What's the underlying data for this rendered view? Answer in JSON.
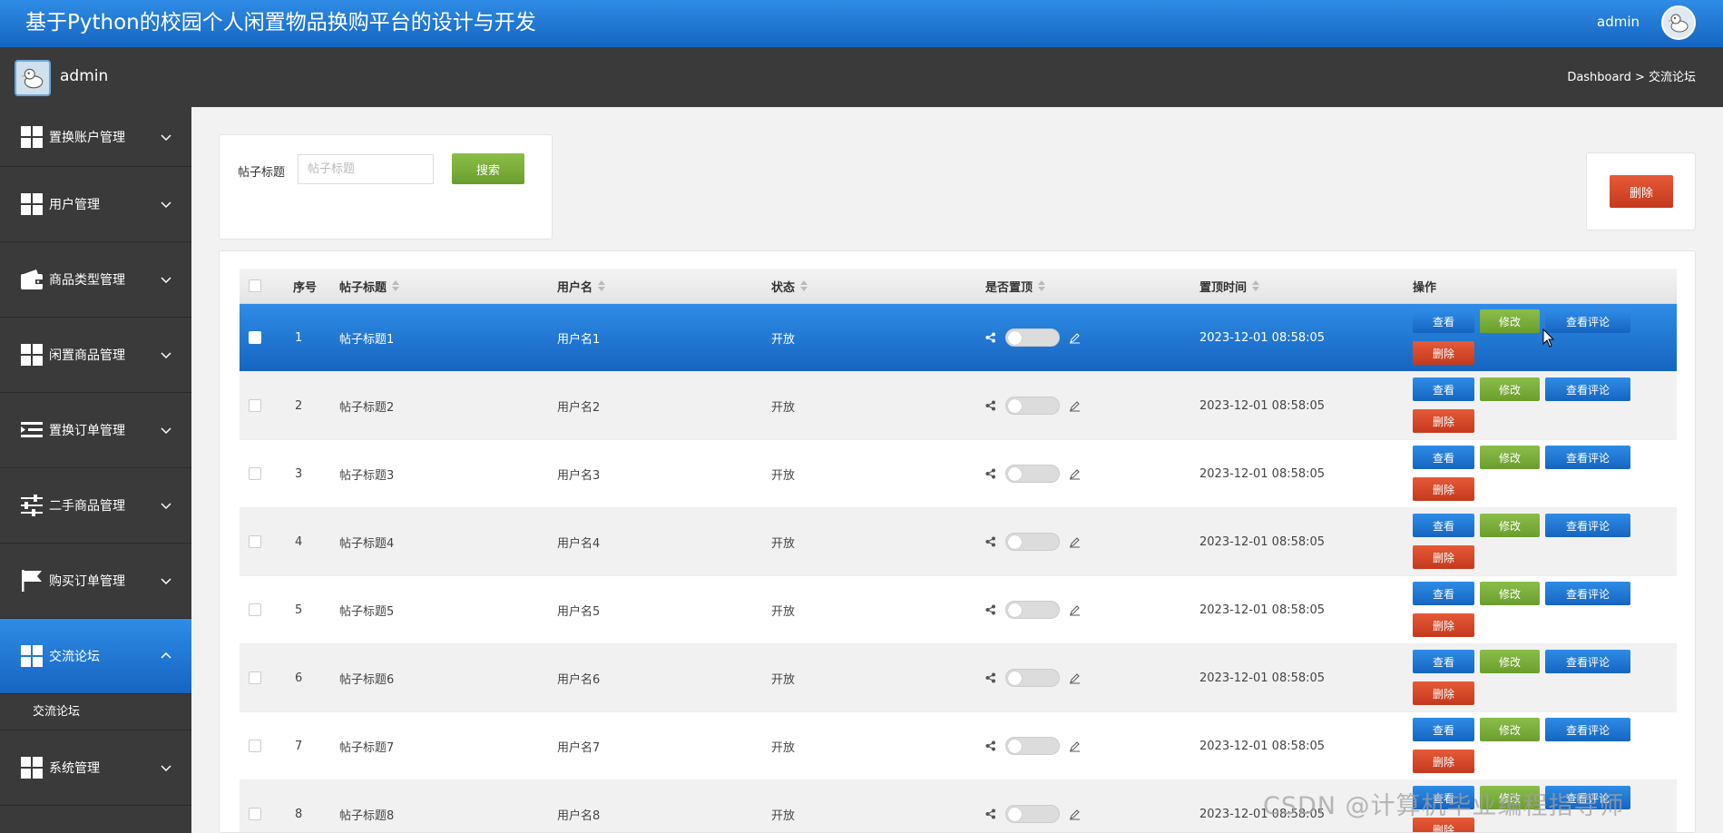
{
  "header": {
    "title": "基于Python的校园个人闲置物品换购平台的设计与开发",
    "user": "admin"
  },
  "subbar": {
    "username": "admin",
    "breadcrumb": "Dashboard > 交流论坛"
  },
  "sidebar": {
    "items": [
      {
        "label": "置换账户管理",
        "icon": "grid-icon"
      },
      {
        "label": "用户管理",
        "icon": "grid-icon"
      },
      {
        "label": "商品类型管理",
        "icon": "wallet-icon"
      },
      {
        "label": "闲置商品管理",
        "icon": "grid-icon"
      },
      {
        "label": "置换订单管理",
        "icon": "list-indent-icon"
      },
      {
        "label": "二手商品管理",
        "icon": "sliders-icon"
      },
      {
        "label": "购买订单管理",
        "icon": "flag-icon"
      },
      {
        "label": "交流论坛",
        "icon": "grid-icon",
        "active": true
      },
      {
        "label": "系统管理",
        "icon": "grid-icon"
      }
    ],
    "submenu": {
      "label": "交流论坛"
    }
  },
  "search": {
    "label": "帖子标题",
    "placeholder": "帖子标题",
    "button": "搜索"
  },
  "toolbar": {
    "delete_label": "删除"
  },
  "table": {
    "headers": [
      "序号",
      "帖子标题",
      "用户名",
      "状态",
      "是否置顶",
      "置顶时间",
      "操作"
    ],
    "actions": {
      "view": "查看",
      "edit": "修改",
      "comments": "查看评论",
      "delete": "删除"
    },
    "rows": [
      {
        "idx": "1",
        "title": "帖子标题1",
        "user": "用户名1",
        "status": "开放",
        "time": "2023-12-01 08:58:05"
      },
      {
        "idx": "2",
        "title": "帖子标题2",
        "user": "用户名2",
        "status": "开放",
        "time": "2023-12-01 08:58:05"
      },
      {
        "idx": "3",
        "title": "帖子标题3",
        "user": "用户名3",
        "status": "开放",
        "time": "2023-12-01 08:58:05"
      },
      {
        "idx": "4",
        "title": "帖子标题4",
        "user": "用户名4",
        "status": "开放",
        "time": "2023-12-01 08:58:05"
      },
      {
        "idx": "5",
        "title": "帖子标题5",
        "user": "用户名5",
        "status": "开放",
        "time": "2023-12-01 08:58:05"
      },
      {
        "idx": "6",
        "title": "帖子标题6",
        "user": "用户名6",
        "status": "开放",
        "time": "2023-12-01 08:58:05"
      },
      {
        "idx": "7",
        "title": "帖子标题7",
        "user": "用户名7",
        "status": "开放",
        "time": "2023-12-01 08:58:05"
      },
      {
        "idx": "8",
        "title": "帖子标题8",
        "user": "用户名8",
        "status": "开放",
        "time": "2023-12-01 08:58:05"
      }
    ]
  },
  "watermark": "CSDN @计算机毕业编程指导师",
  "colors": {
    "primary": "#1565c0",
    "success": "#6a9e2c",
    "danger": "#c4391d",
    "sidebar": "#3a3a3a"
  }
}
